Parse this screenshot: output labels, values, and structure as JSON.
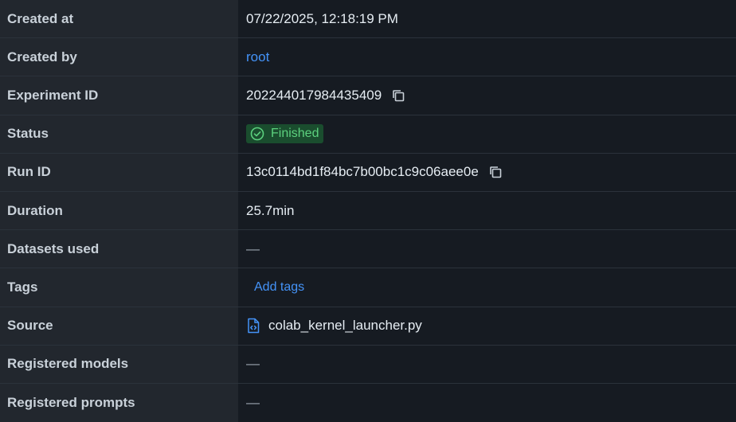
{
  "rows": {
    "created_at": {
      "label": "Created at",
      "value": "07/22/2025, 12:18:19 PM"
    },
    "created_by": {
      "label": "Created by",
      "value": "root"
    },
    "experiment_id": {
      "label": "Experiment ID",
      "value": "202244017984435409",
      "copy_icon": "copy-icon"
    },
    "status": {
      "label": "Status",
      "value": "Finished",
      "icon": "check-circle-icon",
      "color": "#5cd17e",
      "bg_color": "#1a4d2e"
    },
    "run_id": {
      "label": "Run ID",
      "value": "13c0114bd1f84bc7b00bc1c9c06aee0e",
      "copy_icon": "copy-icon"
    },
    "duration": {
      "label": "Duration",
      "value": "25.7min"
    },
    "datasets_used": {
      "label": "Datasets used",
      "value": "—"
    },
    "tags": {
      "label": "Tags",
      "action": "Add tags"
    },
    "source": {
      "label": "Source",
      "value": "colab_kernel_launcher.py",
      "icon": "python-file-icon"
    },
    "registered_models": {
      "label": "Registered models",
      "value": "—"
    },
    "registered_prompts": {
      "label": "Registered prompts",
      "value": "—"
    }
  },
  "colors": {
    "link": "#4493f8",
    "key_bg": "#22272e",
    "value_bg": "#161b22"
  }
}
